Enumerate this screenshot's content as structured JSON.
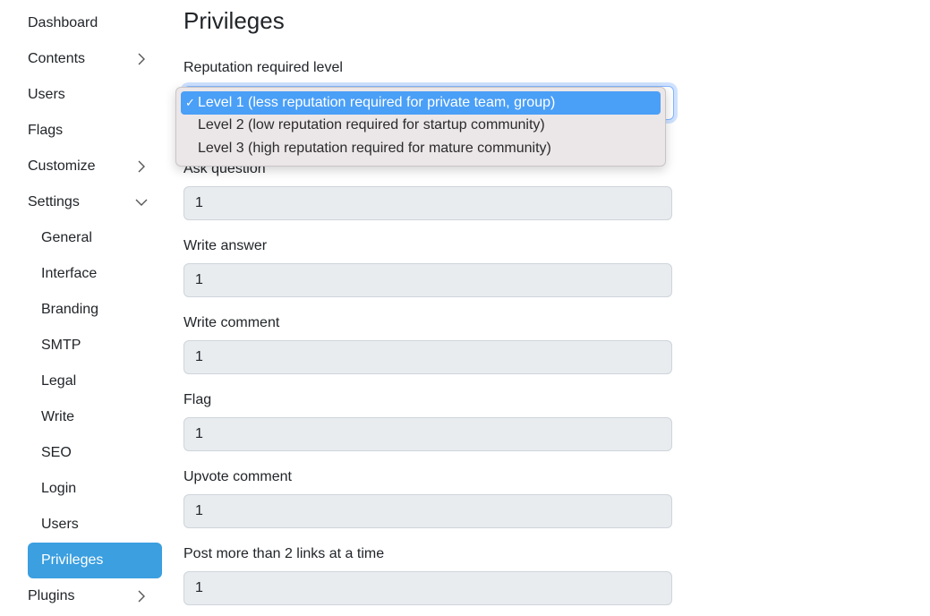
{
  "sidebar": {
    "items": [
      {
        "label": "Dashboard",
        "chevron": null
      },
      {
        "label": "Contents",
        "chevron": "right"
      },
      {
        "label": "Users",
        "chevron": null
      },
      {
        "label": "Flags",
        "chevron": null
      },
      {
        "label": "Customize",
        "chevron": "right"
      },
      {
        "label": "Settings",
        "chevron": "down"
      }
    ],
    "settings_items": [
      "General",
      "Interface",
      "Branding",
      "SMTP",
      "Legal",
      "Write",
      "SEO",
      "Login",
      "Users",
      "Privileges"
    ],
    "active": "Privileges",
    "last_item": {
      "label": "Plugins",
      "chevron": "right"
    }
  },
  "page": {
    "title": "Privileges",
    "reputation_label": "Reputation required level",
    "dropdown": {
      "options": [
        "Level 1 (less reputation required for private team, group)",
        "Level 2 (low reputation required for startup community)",
        "Level 3 (high reputation required for mature community)"
      ],
      "selected_index": 0,
      "check": "✓"
    },
    "fields": [
      {
        "label": "Ask question",
        "value": "1"
      },
      {
        "label": "Write answer",
        "value": "1"
      },
      {
        "label": "Write comment",
        "value": "1"
      },
      {
        "label": "Flag",
        "value": "1"
      },
      {
        "label": "Upvote comment",
        "value": "1"
      },
      {
        "label": "Post more than 2 links at a time",
        "value": "1"
      }
    ]
  },
  "colors": {
    "active": "#3b9fe0",
    "selected_option": "#4a9ff7"
  }
}
